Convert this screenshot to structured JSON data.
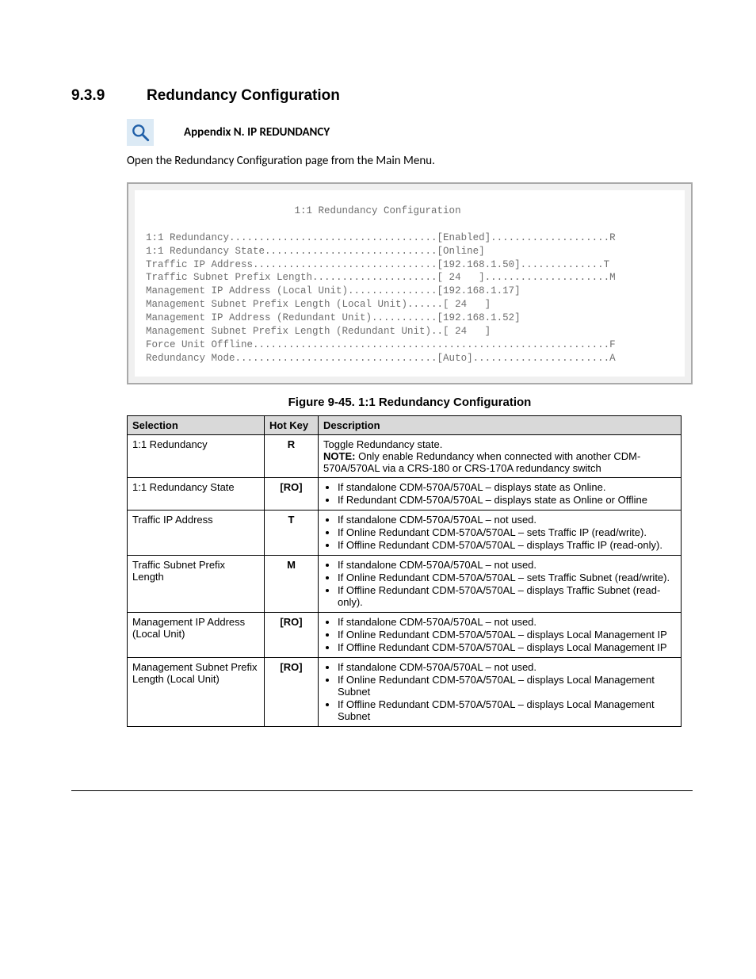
{
  "heading": {
    "number": "9.3.9",
    "title": "Redundancy Configuration"
  },
  "appendix": "Appendix N. IP REDUNDANCY",
  "intro": "Open the Redundancy Configuration page from the Main Menu.",
  "terminal": "                         1:1 Redundancy Configuration\n\n1:1 Redundancy...................................[Enabled]....................R\n1:1 Redundancy State.............................[Online]\nTraffic IP Address...............................[192.168.1.50]..............T\nTraffic Subnet Prefix Length.....................[ 24   ].....................M\nManagement IP Address (Local Unit)...............[192.168.1.17]\nManagement Subnet Prefix Length (Local Unit)......[ 24   ]\nManagement IP Address (Redundant Unit)...........[192.168.1.52]\nManagement Subnet Prefix Length (Redundant Unit)..[ 24   ]\nForce Unit Offline............................................................F\nRedundancy Mode..................................[Auto].......................A",
  "figure_caption": "Figure 9-45. 1:1 Redundancy Configuration",
  "table": {
    "headers": {
      "sel": "Selection",
      "hot": "Hot Key",
      "desc": "Description"
    },
    "rows": [
      {
        "sel": "1:1 Redundancy",
        "hot": "R",
        "desc_plain": "Toggle Redundancy state.",
        "note_label": "NOTE:",
        "note_text": " Only enable Redundancy when connected with another CDM-570A/570AL via a CRS-180 or CRS-170A redundancy switch"
      },
      {
        "sel": "1:1 Redundancy State",
        "hot": "[RO]",
        "bullets": [
          "If standalone CDM-570A/570AL – displays state as Online.",
          "If Redundant CDM-570A/570AL – displays state as Online or Offline"
        ]
      },
      {
        "sel": "Traffic IP Address",
        "hot": "T",
        "bullets": [
          "If standalone CDM-570A/570AL – not used.",
          "If Online Redundant CDM-570A/570AL – sets Traffic IP (read/write).",
          "If Offline Redundant CDM-570A/570AL – displays Traffic IP (read-only)."
        ]
      },
      {
        "sel": "Traffic Subnet Prefix Length",
        "hot": "M",
        "bullets": [
          "If standalone CDM-570A/570AL – not used.",
          "If Online Redundant CDM-570A/570AL – sets Traffic Subnet (read/write).",
          "If Offline Redundant CDM-570A/570AL – displays Traffic Subnet (read-only)."
        ]
      },
      {
        "sel": "Management IP Address (Local Unit)",
        "hot": "[RO]",
        "bullets": [
          "If standalone CDM-570A/570AL – not used.",
          "If Online Redundant CDM-570A/570AL – displays Local Management IP",
          "If Offline Redundant CDM-570A/570AL – displays Local Management IP"
        ]
      },
      {
        "sel": "Management Subnet Prefix Length (Local Unit)",
        "hot": "[RO]",
        "bullets": [
          "If standalone CDM-570A/570AL – not used.",
          "If Online Redundant CDM-570A/570AL – displays Local Management Subnet",
          "If Offline Redundant CDM-570A/570AL – displays Local Management Subnet"
        ]
      }
    ]
  }
}
